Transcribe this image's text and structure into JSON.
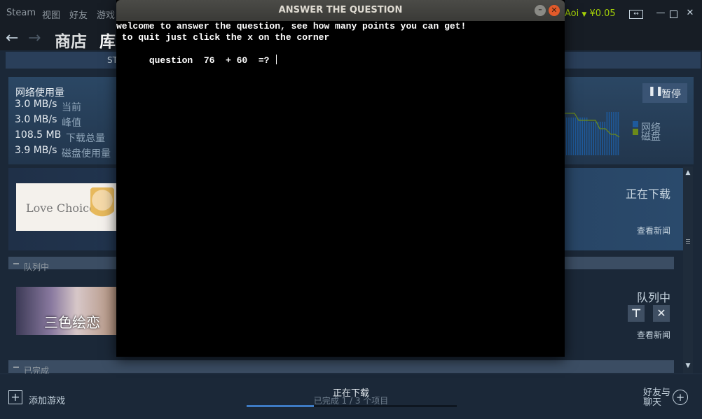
{
  "menubar": {
    "items": [
      "Steam",
      "视图",
      "好友",
      "游戏"
    ],
    "user": "Aoi",
    "balance": "¥0.05"
  },
  "nav": {
    "store": "商店",
    "library": "库"
  },
  "subnav": {
    "label": "ST"
  },
  "stats": {
    "title": "网络使用量",
    "current_value": "3.0 MB/s",
    "current_label": "当前",
    "peak_value": "3.0 MB/s",
    "peak_label": "峰值",
    "total_value": "108.5 MB",
    "total_label": "下载总量",
    "disk_value": "3.9 MB/s",
    "disk_label": "磁盘使用量",
    "pause_label": "暂停",
    "legend_network": "网络",
    "legend_disk": "磁盘",
    "colors": {
      "network": "#1e5a9c",
      "disk": "#6b8a1a"
    }
  },
  "active_download": {
    "thumb_text": "Love Choice",
    "status": "正在下载",
    "news": "查看新闻"
  },
  "queued": {
    "header": "队列中",
    "thumb_text": "三色绘恋",
    "status": "队列中",
    "news": "查看新闻"
  },
  "completed": {
    "header": "已完成"
  },
  "bottombar": {
    "add_game": "添加游戏",
    "downloading": "正在下载",
    "progress_text": "已完成 1 / 3 个项目",
    "progress_fraction": 0.32,
    "friends_line1": "好友与",
    "friends_line2": "聊天"
  },
  "terminal": {
    "title": "ANSWER THE QUESTION",
    "line1": "welcome to answer the question, see how many points you can get!",
    "line2": " to quit just click the x on the corner",
    "line3": "question  76  + 60  =? "
  }
}
